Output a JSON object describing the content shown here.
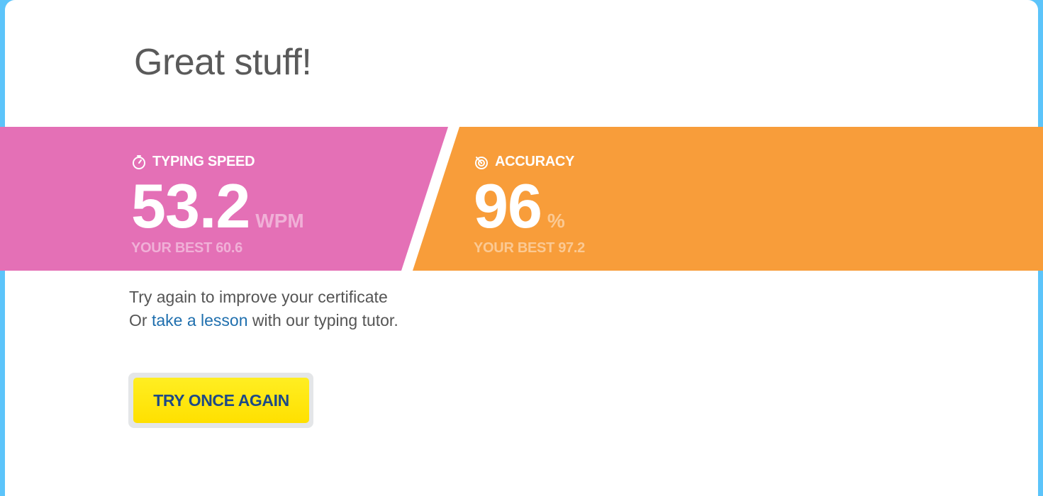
{
  "headline": "Great stuff!",
  "stats": {
    "speed": {
      "label": "TYPING SPEED",
      "icon": "stopwatch-icon",
      "value": "53.2",
      "unit": "WPM",
      "best": "YOUR BEST 60.6",
      "color": "#e470b6"
    },
    "accuracy": {
      "label": "ACCURACY",
      "icon": "target-icon",
      "value": "96",
      "unit": "%",
      "best": "YOUR BEST 97.2",
      "color": "#f89d3a"
    }
  },
  "message": {
    "line1": "Try again to improve your certificate",
    "line2_prefix": "Or ",
    "line2_link": "take a lesson",
    "line2_suffix": " with our typing tutor."
  },
  "actions": {
    "retry_label": "TRY ONCE AGAIN",
    "button_color": "#ffe400",
    "button_text_color": "#1e4a86"
  },
  "colors": {
    "background": "#5cc4fa",
    "card": "#ffffff",
    "link": "#1f6fae"
  }
}
